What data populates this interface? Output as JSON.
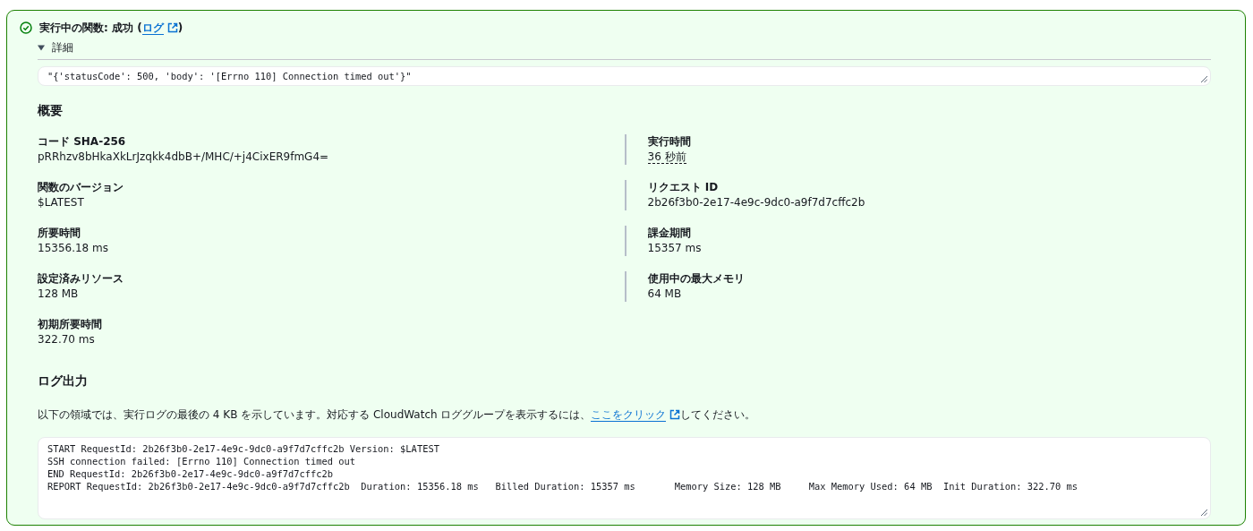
{
  "status": {
    "title_prefix": "実行中の関数: 成功 (",
    "link": "ログ",
    "title_suffix": ")"
  },
  "details": {
    "label": "詳細",
    "expanded": true,
    "output": "\"{'statusCode': 500, 'body': '[Errno 110] Connection timed out'}\""
  },
  "summary": {
    "heading": "概要",
    "left": [
      {
        "label": "コード SHA-256",
        "value": "pRRhzv8bHkaXkLrJzqkk4dbB+/MHC/+j4CixER9fmG4=",
        "underlined": false
      },
      {
        "label": "関数のバージョン",
        "value": "$LATEST",
        "underlined": false
      },
      {
        "label": "所要時間",
        "value": "15356.18 ms",
        "underlined": false
      },
      {
        "label": "設定済みリソース",
        "value": "128 MB",
        "underlined": false
      },
      {
        "label": "初期所要時間",
        "value": "322.70 ms",
        "underlined": false
      }
    ],
    "right": [
      {
        "label": "実行時間",
        "value": "36 秒前",
        "underlined": true
      },
      {
        "label": "リクエスト ID",
        "value": "2b26f3b0-2e17-4e9c-9dc0-a9f7d7cffc2b",
        "underlined": false
      },
      {
        "label": "課金期間",
        "value": "15357 ms",
        "underlined": false
      },
      {
        "label": "使用中の最大メモリ",
        "value": "64 MB",
        "underlined": false
      }
    ]
  },
  "log_output": {
    "heading": "ログ出力",
    "note_before": "以下の領域では、実行ログの最後の 4 KB を示しています。対応する CloudWatch ロググループを表示するには、",
    "link": "ここをクリック",
    "note_after": "してください。",
    "lines": [
      "START RequestId: 2b26f3b0-2e17-4e9c-9dc0-a9f7d7cffc2b Version: $LATEST",
      "SSH connection failed: [Errno 110] Connection timed out",
      "END RequestId: 2b26f3b0-2e17-4e9c-9dc0-a9f7d7cffc2b",
      "REPORT RequestId: 2b26f3b0-2e17-4e9c-9dc0-a9f7d7cffc2b  Duration: 15356.18 ms   Billed Duration: 15357 ms       Memory Size: 128 MB     Max Memory Used: 64 MB  Init Duration: 322.70 ms"
    ]
  }
}
